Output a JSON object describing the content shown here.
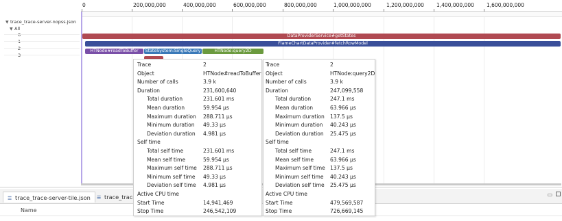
{
  "tree": {
    "file": "trace_trace-server-nopss.json",
    "all_label": "All",
    "rows": [
      "0",
      "1",
      "2",
      "3"
    ]
  },
  "ruler": {
    "ticks": [
      "0",
      "200,000,000",
      "400,000,000",
      "600,000,000",
      "800,000,000",
      "1,000,000,000",
      "1,200,000,000",
      "1,400,000,000",
      "1,600,000,000"
    ]
  },
  "bars": [
    {
      "label": "DataProviderService#getStates",
      "color": "#b04a52"
    },
    {
      "label": "FlameChartDataProvider#fetchRowModel",
      "color": "#3a4f9a"
    },
    {
      "label": "HTNode#readToBuffer",
      "color": "#7a4fa8"
    },
    {
      "label": "StateSystem:SingleQuery",
      "color": "#3a79b8"
    },
    {
      "label": "HTNode:query2D",
      "color": "#6b9a3e"
    },
    {
      "label": "",
      "color": "#b04a52"
    }
  ],
  "tooltip_left": {
    "rows": [
      {
        "key": "Trace",
        "value": "2"
      },
      {
        "key": "Object",
        "value": "HTNode#readToBuffer"
      },
      {
        "key": "Number of calls",
        "value": "3.9 k"
      },
      {
        "key": "Duration",
        "value": "231,600,640"
      },
      {
        "key": "Total duration",
        "value": "231.601 ms"
      },
      {
        "key": "Mean duration",
        "value": "59.954 µs"
      },
      {
        "key": "Maximum duration",
        "value": "288.711 µs"
      },
      {
        "key": "Minimum duration",
        "value": "49.33 µs"
      },
      {
        "key": "Deviation duration",
        "value": "4.981 µs"
      },
      {
        "key": "Self time",
        "value": ""
      },
      {
        "key": "Total self time",
        "value": "231.601 ms"
      },
      {
        "key": "Mean self time",
        "value": "59.954 µs"
      },
      {
        "key": "Maximum self time",
        "value": "288.711 µs"
      },
      {
        "key": "Minimum self time",
        "value": "49.33 µs"
      },
      {
        "key": "Deviation self time",
        "value": "4.981 µs"
      },
      {
        "key": "Active CPU time",
        "value": ""
      },
      {
        "key": "Start Time",
        "value": "14,941,469"
      },
      {
        "key": "Stop Time",
        "value": "246,542,109"
      }
    ]
  },
  "tooltip_right": {
    "rows": [
      {
        "key": "Trace",
        "value": "2"
      },
      {
        "key": "Object",
        "value": "HTNode:query2D"
      },
      {
        "key": "Number of calls",
        "value": "3.9 k"
      },
      {
        "key": "Duration",
        "value": "247,099,558"
      },
      {
        "key": "Total duration",
        "value": "247.1 ms"
      },
      {
        "key": "Mean duration",
        "value": "63.966 µs"
      },
      {
        "key": "Maximum duration",
        "value": "137.5 µs"
      },
      {
        "key": "Minimum duration",
        "value": "40.243 µs"
      },
      {
        "key": "Deviation duration",
        "value": "25.475 µs"
      },
      {
        "key": "Self time",
        "value": ""
      },
      {
        "key": "Total self time",
        "value": "247.1 ms"
      },
      {
        "key": "Mean self time",
        "value": "63.966 µs"
      },
      {
        "key": "Maximum self time",
        "value": "137.5 µs"
      },
      {
        "key": "Minimum self time",
        "value": "40.243 µs"
      },
      {
        "key": "Deviation self time",
        "value": "25.475 µs"
      },
      {
        "key": "Active CPU time",
        "value": ""
      },
      {
        "key": "Start Time",
        "value": "479,569,587"
      },
      {
        "key": "Stop Time",
        "value": "726,669,145"
      }
    ]
  },
  "tabs": [
    {
      "label": "trace_trace-server-tile.json"
    },
    {
      "label": "trace_trace"
    }
  ],
  "table": {
    "column_name": "Name"
  }
}
